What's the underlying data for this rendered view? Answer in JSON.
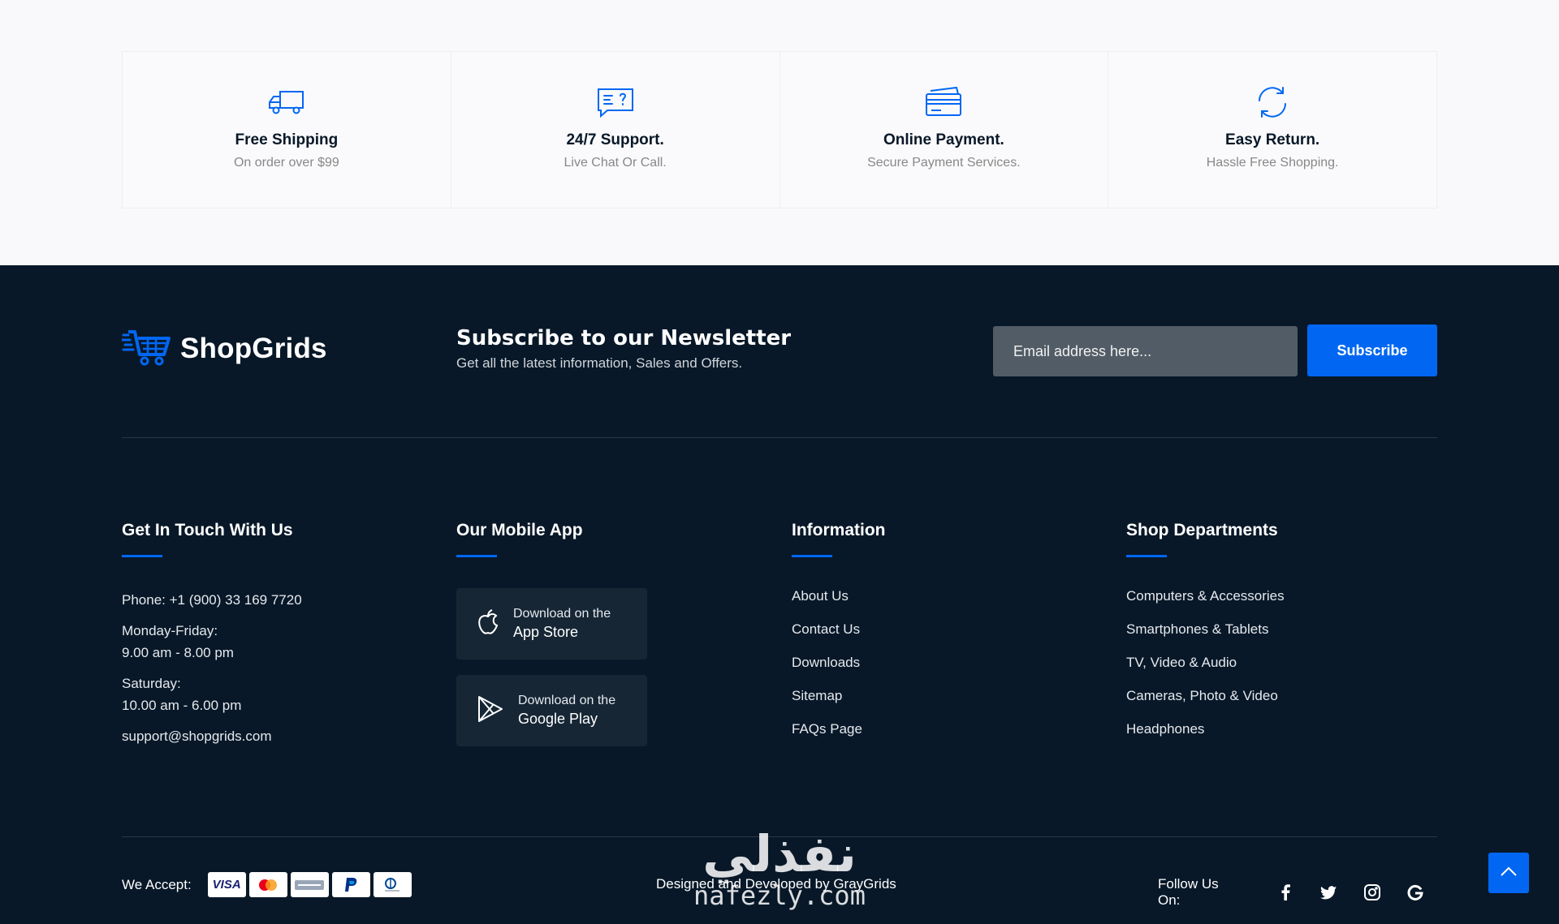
{
  "features": [
    {
      "icon": "truck-icon",
      "title": "Free Shipping",
      "subtitle": "On order over $99"
    },
    {
      "icon": "chat-icon",
      "title": "24/7 Support.",
      "subtitle": "Live Chat Or Call."
    },
    {
      "icon": "credit-card-icon",
      "title": "Online Payment.",
      "subtitle": "Secure Payment Services."
    },
    {
      "icon": "refresh-icon",
      "title": "Easy Return.",
      "subtitle": "Hassle Free Shopping."
    }
  ],
  "footer": {
    "brand": "ShopGrids",
    "newsletter": {
      "title": "Subscribe to our Newsletter",
      "subtitle": "Get all the latest information, Sales and Offers.",
      "placeholder": "Email address here...",
      "button": "Subscribe"
    },
    "contact": {
      "title": "Get In Touch With Us",
      "phone": "Phone: +1 (900) 33 169 7720",
      "weekday_label": "Monday-Friday:",
      "weekday_hours": "9.00 am - 8.00 pm",
      "saturday_label": "Saturday:",
      "saturday_hours": "10.00 am - 6.00 pm",
      "email": "support@shopgrids.com"
    },
    "app": {
      "title": "Our Mobile App",
      "stores": [
        {
          "line1": "Download on the",
          "line2": "App Store",
          "icon": "apple-icon"
        },
        {
          "line1": "Download on the",
          "line2": "Google Play",
          "icon": "google-play-icon"
        }
      ]
    },
    "information": {
      "title": "Information",
      "links": [
        "About Us",
        "Contact Us",
        "Downloads",
        "Sitemap",
        "FAQs Page"
      ]
    },
    "departments": {
      "title": "Shop Departments",
      "links": [
        "Computers & Accessories",
        "Smartphones & Tablets",
        "TV, Video & Audio",
        "Cameras, Photo & Video",
        "Headphones"
      ]
    },
    "bottom": {
      "accept_label": "We Accept:",
      "cards": [
        "VISA",
        "mastercard",
        "AMERICAN EXPRESS",
        "PayPal",
        "Diners Club"
      ],
      "credit": "Designed and Developed by GrayGrids",
      "follow_label": "Follow Us On:",
      "socials": [
        "facebook-icon",
        "twitter-icon",
        "instagram-icon",
        "google-icon"
      ]
    },
    "watermark": {
      "arabic": "نفذلي",
      "latin": "nafezly.com"
    }
  },
  "colors": {
    "accent": "#0167f3",
    "footer_bg": "#081828",
    "page_bg": "#f9f9fb"
  }
}
